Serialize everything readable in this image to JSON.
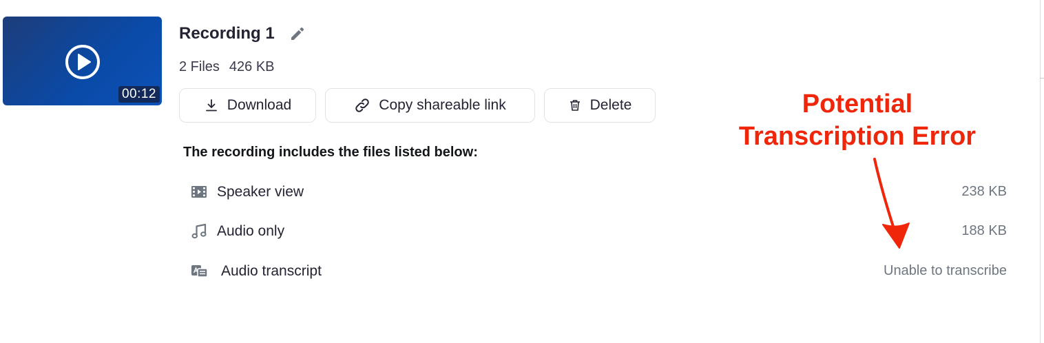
{
  "recording": {
    "title": "Recording 1",
    "duration": "00:12",
    "file_count": "2 Files",
    "total_size": "426 KB"
  },
  "actions": {
    "download_label": "Download",
    "copy_link_label": "Copy shareable link",
    "delete_label": "Delete"
  },
  "files_heading": "The recording includes the files listed below:",
  "files": [
    {
      "name": "Speaker view",
      "value": "238 KB",
      "icon": "video-icon"
    },
    {
      "name": "Audio only",
      "value": "188 KB",
      "icon": "music-note-icon"
    },
    {
      "name": "Audio transcript",
      "value": "Unable to transcribe",
      "icon": "transcript-icon"
    }
  ],
  "annotation": {
    "line1": "Potential",
    "line2": "Transcription Error",
    "color": "#f0260a"
  },
  "colors": {
    "thumbnail": "#0a4aa8",
    "text": "#232333",
    "muted": "#6e7680"
  }
}
